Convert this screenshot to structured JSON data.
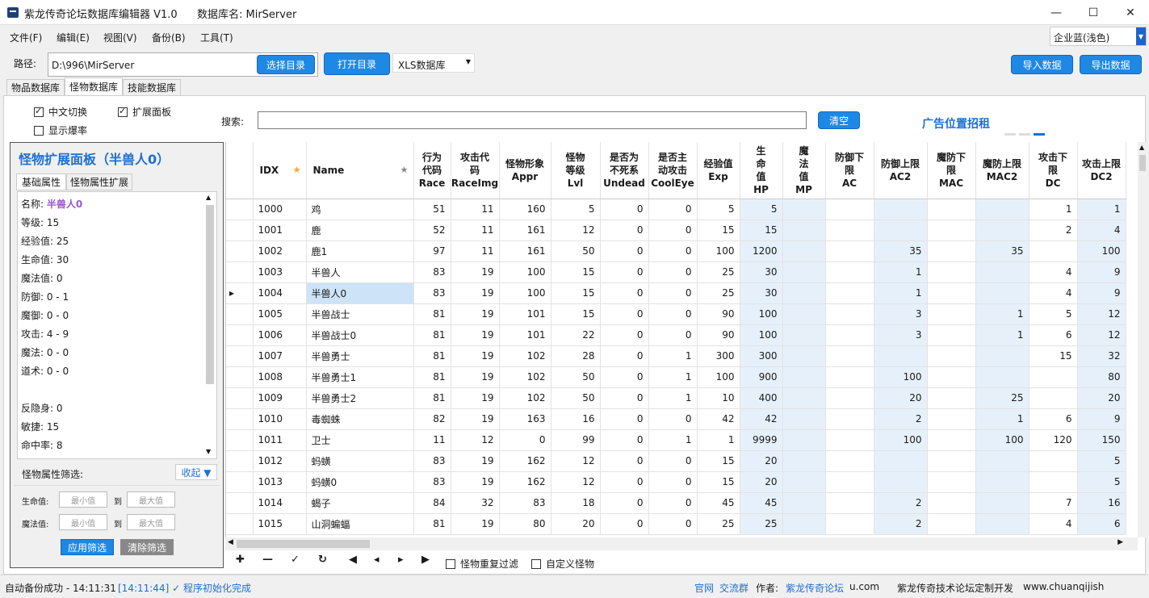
{
  "window": {
    "title": "紫龙传奇论坛数据库编辑器 V1.0",
    "db_label": "数据库名: MirServer",
    "controls": {
      "minimize": "—",
      "maximize": "☐",
      "close": "✕"
    }
  },
  "menu": [
    "文件(F)",
    "编辑(E)",
    "视图(V)",
    "备份(B)",
    "工具(T)"
  ],
  "theme": {
    "value": "企业蓝(浅色)"
  },
  "path": {
    "label": "路径:",
    "value": "D:\\996\\MirServer",
    "choose": "选择目录",
    "open": "打开目录",
    "dbtype": "XLS数据库",
    "import": "导入数据",
    "export": "导出数据"
  },
  "tabs": [
    "物品数据库",
    "怪物数据库",
    "技能数据库"
  ],
  "options": {
    "cn_switch": "中文切换",
    "expand_panel": "扩展面板",
    "show_drop": "显示爆率"
  },
  "search": {
    "label": "搜索:",
    "value": "",
    "clear": "清空"
  },
  "ad": "广告位置招租",
  "panel": {
    "title": "怪物扩展面板（半兽人0）",
    "tabs": [
      "基础属性",
      "怪物属性扩展"
    ],
    "attrs": [
      {
        "k": "名称: ",
        "v": "半兽人0"
      },
      {
        "k": "等级: 15",
        "v": ""
      },
      {
        "k": "经验值: 25",
        "v": ""
      },
      {
        "k": "生命值: 30",
        "v": ""
      },
      {
        "k": "魔法值: 0",
        "v": ""
      },
      {
        "k": "防御: 0 - 1",
        "v": ""
      },
      {
        "k": "魔御: 0 - 0",
        "v": ""
      },
      {
        "k": "攻击: 4 - 9",
        "v": ""
      },
      {
        "k": "魔法: 0 - 0",
        "v": ""
      },
      {
        "k": "道术: 0 - 0",
        "v": ""
      },
      {
        "k": "",
        "v": ""
      },
      {
        "k": "反隐身: 0",
        "v": ""
      },
      {
        "k": "敏捷: 15",
        "v": ""
      },
      {
        "k": "命中率: 8",
        "v": ""
      }
    ],
    "filter_label": "怪物属性筛选:",
    "collapse": "收起 ▼",
    "hp_label": "生命值:",
    "mp_label": "魔法值:",
    "min_ph": "最小值",
    "max_ph": "最大值",
    "to": "到",
    "apply": "应用筛选",
    "reset": "清除筛选"
  },
  "grid": {
    "headers": [
      "IDX",
      "Name",
      "行为\n代码\nRace",
      "攻击代\n码\nRaceImg",
      "怪物形象\nAppr",
      "怪物\n等级\nLvl",
      "是否为\n不死系\nUndead",
      "是否主\n动攻击\nCoolEye",
      "经验值\nExp",
      "生\n命\n值\nHP",
      "魔\n法\n值\nMP",
      "防御下\n限\nAC",
      "防御上限\nAC2",
      "魔防下\n限\nMAC",
      "魔防上限\nMAC2",
      "攻击下\n限\nDC",
      "攻击上限\nDC2"
    ],
    "rows": [
      [
        "1000",
        "鸡",
        "51",
        "11",
        "160",
        "5",
        "0",
        "0",
        "5",
        "5",
        "",
        "",
        "",
        "",
        "",
        "1",
        "1"
      ],
      [
        "1001",
        "鹿",
        "52",
        "11",
        "161",
        "12",
        "0",
        "0",
        "15",
        "15",
        "",
        "",
        "",
        "",
        "",
        "2",
        "4"
      ],
      [
        "1002",
        "鹿1",
        "97",
        "11",
        "161",
        "50",
        "0",
        "0",
        "100",
        "1200",
        "",
        "",
        "35",
        "",
        "35",
        "",
        "100"
      ],
      [
        "1003",
        "半兽人",
        "83",
        "19",
        "100",
        "15",
        "0",
        "0",
        "25",
        "30",
        "",
        "",
        "1",
        "",
        "",
        "4",
        "9"
      ],
      [
        "1004",
        "半兽人0",
        "83",
        "19",
        "100",
        "15",
        "0",
        "0",
        "25",
        "30",
        "",
        "",
        "1",
        "",
        "",
        "4",
        "9"
      ],
      [
        "1005",
        "半兽战士",
        "81",
        "19",
        "101",
        "15",
        "0",
        "0",
        "90",
        "100",
        "",
        "",
        "3",
        "",
        "1",
        "5",
        "12"
      ],
      [
        "1006",
        "半兽战士0",
        "81",
        "19",
        "101",
        "22",
        "0",
        "0",
        "90",
        "100",
        "",
        "",
        "3",
        "",
        "1",
        "6",
        "12"
      ],
      [
        "1007",
        "半兽勇士",
        "81",
        "19",
        "102",
        "28",
        "0",
        "1",
        "300",
        "300",
        "",
        "",
        "",
        "",
        "",
        "15",
        "32"
      ],
      [
        "1008",
        "半兽勇士1",
        "81",
        "19",
        "102",
        "50",
        "0",
        "1",
        "100",
        "900",
        "",
        "",
        "100",
        "",
        "",
        "",
        "80"
      ],
      [
        "1009",
        "半兽勇士2",
        "81",
        "19",
        "102",
        "50",
        "0",
        "1",
        "10",
        "400",
        "",
        "",
        "20",
        "",
        "25",
        "",
        "20"
      ],
      [
        "1010",
        "毒蜘蛛",
        "82",
        "19",
        "163",
        "16",
        "0",
        "0",
        "42",
        "42",
        "",
        "",
        "2",
        "",
        "1",
        "6",
        "9"
      ],
      [
        "1011",
        "卫士",
        "11",
        "12",
        "0",
        "99",
        "0",
        "1",
        "1",
        "9999",
        "",
        "",
        "100",
        "",
        "100",
        "120",
        "150"
      ],
      [
        "1012",
        "蚂蟥",
        "83",
        "19",
        "162",
        "12",
        "0",
        "0",
        "15",
        "20",
        "",
        "",
        "",
        "",
        "",
        "",
        "5"
      ],
      [
        "1013",
        "蚂蟥0",
        "83",
        "19",
        "162",
        "12",
        "0",
        "0",
        "15",
        "20",
        "",
        "",
        "",
        "",
        "",
        "",
        "5"
      ],
      [
        "1014",
        "蝎子",
        "84",
        "32",
        "83",
        "18",
        "0",
        "0",
        "45",
        "45",
        "",
        "",
        "2",
        "",
        "",
        "7",
        "16"
      ],
      [
        "1015",
        "山洞蝙蝠",
        "81",
        "19",
        "80",
        "20",
        "0",
        "0",
        "25",
        "25",
        "",
        "",
        "2",
        "",
        "",
        "4",
        "6"
      ]
    ],
    "selected_row": 4
  },
  "toolbar": {
    "add": "✚",
    "remove": "—",
    "confirm": "✓",
    "refresh": "↻",
    "first": "◀",
    "prev": "◂",
    "next": "▸",
    "last": "▶",
    "dup_filter": "怪物重复过滤",
    "custom": "自定义怪物"
  },
  "status": {
    "backup": "自动备份成功 - 14:11:31",
    "log": "[14:11:44] ✓ 程序初始化完成",
    "site": "官网",
    "group": "交流群",
    "author": "作者:",
    "forum": "紫龙传奇论坛",
    "ucom": "u.com",
    "dev": "紫龙传奇技术论坛定制开发",
    "url": "www.chuanqijish"
  }
}
